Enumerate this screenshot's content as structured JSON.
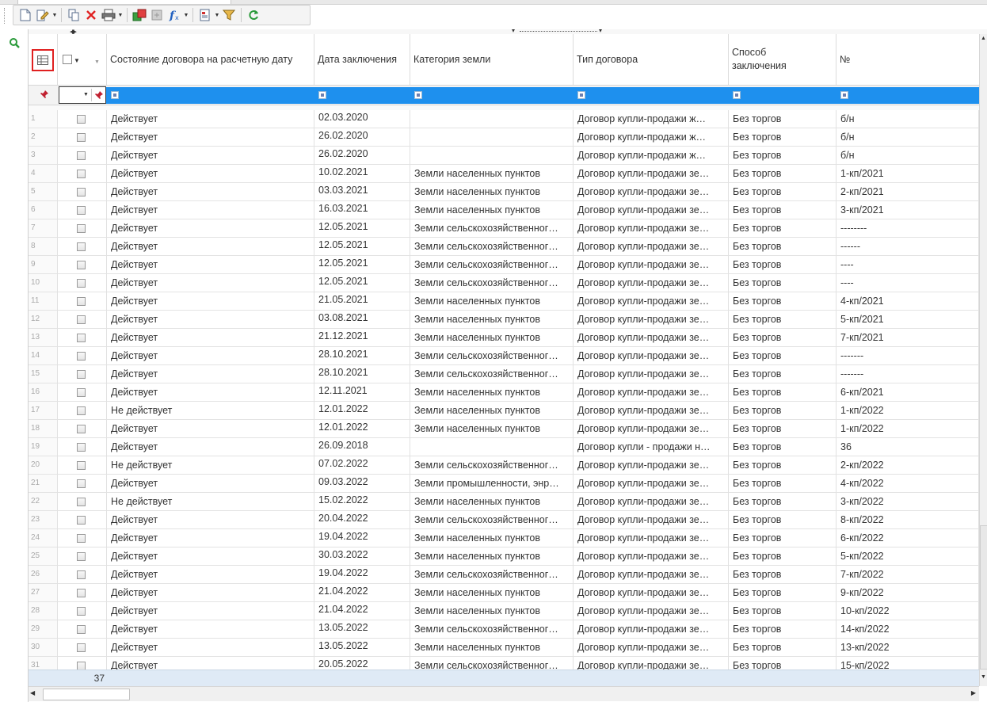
{
  "columns": {
    "state": "Состояние договора на расчетную дату",
    "date": "Дата заключения",
    "category": "Категория земли",
    "type": "Тип договора",
    "method": "Способ заключения",
    "number": "№"
  },
  "rows": [
    {
      "n": "1",
      "state": "Действует",
      "date": "02.03.2020",
      "category": "",
      "type": "Договор купли-продажи ж…",
      "method": "Без торгов",
      "number": "б/н"
    },
    {
      "n": "2",
      "state": "Действует",
      "date": "26.02.2020",
      "category": "",
      "type": "Договор купли-продажи ж…",
      "method": "Без торгов",
      "number": "  б/н"
    },
    {
      "n": "3",
      "state": "Действует",
      "date": "26.02.2020",
      "category": "",
      "type": "Договор купли-продажи ж…",
      "method": "Без торгов",
      "number": "   б/н"
    },
    {
      "n": "4",
      "state": "Действует",
      "date": "10.02.2021",
      "category": "Земли населенных пунктов",
      "type": "Договор купли-продажи зе…",
      "method": "Без торгов",
      "number": "1-кп/2021"
    },
    {
      "n": "5",
      "state": "Действует",
      "date": "03.03.2021",
      "category": "Земли населенных пунктов",
      "type": "Договор купли-продажи зе…",
      "method": "Без торгов",
      "number": "2-кп/2021"
    },
    {
      "n": "6",
      "state": "Действует",
      "date": "16.03.2021",
      "category": "Земли населенных пунктов",
      "type": "Договор купли-продажи зе…",
      "method": "Без торгов",
      "number": "3-кп/2021"
    },
    {
      "n": "7",
      "state": "Действует",
      "date": "12.05.2021",
      "category": "Земли сельскохозяйственног…",
      "type": "Договор купли-продажи зе…",
      "method": "Без торгов",
      "number": "--------"
    },
    {
      "n": "8",
      "state": "Действует",
      "date": "12.05.2021",
      "category": "Земли сельскохозяйственног…",
      "type": "Договор купли-продажи зе…",
      "method": "Без торгов",
      "number": "------"
    },
    {
      "n": "9",
      "state": "Действует",
      "date": "12.05.2021",
      "category": "Земли сельскохозяйственног…",
      "type": "Договор купли-продажи зе…",
      "method": "Без торгов",
      "number": "----"
    },
    {
      "n": "10",
      "state": "Действует",
      "date": "12.05.2021",
      "category": "Земли сельскохозяйственног…",
      "type": "Договор купли-продажи зе…",
      "method": "Без торгов",
      "number": "----"
    },
    {
      "n": "11",
      "state": "Действует",
      "date": "21.05.2021",
      "category": "Земли населенных пунктов",
      "type": "Договор купли-продажи зе…",
      "method": "Без торгов",
      "number": "4-кп/2021"
    },
    {
      "n": "12",
      "state": "Действует",
      "date": "03.08.2021",
      "category": "Земли населенных пунктов",
      "type": "Договор купли-продажи зе…",
      "method": "Без торгов",
      "number": "5-кп/2021"
    },
    {
      "n": "13",
      "state": "Действует",
      "date": "21.12.2021",
      "category": "Земли населенных пунктов",
      "type": "Договор купли-продажи зе…",
      "method": "Без торгов",
      "number": "7-кп/2021"
    },
    {
      "n": "14",
      "state": "Действует",
      "date": "28.10.2021",
      "category": "Земли сельскохозяйственног…",
      "type": "Договор купли-продажи зе…",
      "method": "Без торгов",
      "number": "-------"
    },
    {
      "n": "15",
      "state": "Действует",
      "date": "28.10.2021",
      "category": "Земли сельскохозяйственног…",
      "type": "Договор купли-продажи зе…",
      "method": "Без торгов",
      "number": "-------"
    },
    {
      "n": "16",
      "state": "Действует",
      "date": "12.11.2021",
      "category": "Земли населенных пунктов",
      "type": "Договор купли-продажи зе…",
      "method": "Без торгов",
      "number": "6-кп/2021"
    },
    {
      "n": "17",
      "state": "Не действует",
      "date": "12.01.2022",
      "category": "Земли населенных пунктов",
      "type": "Договор купли-продажи зе…",
      "method": "Без торгов",
      "number": "1-кп/2022"
    },
    {
      "n": "18",
      "state": "Действует",
      "date": "12.01.2022",
      "category": "Земли населенных пунктов",
      "type": "Договор купли-продажи зе…",
      "method": "Без торгов",
      "number": "1-кп/2022"
    },
    {
      "n": "19",
      "state": "Действует",
      "date": "26.09.2018",
      "category": "",
      "type": "Договор купли - продажи н…",
      "method": "Без торгов",
      "number": "36"
    },
    {
      "n": "20",
      "state": "Не действует",
      "date": "07.02.2022",
      "category": "Земли сельскохозяйственног…",
      "type": "Договор купли-продажи зе…",
      "method": "Без торгов",
      "number": "2-кп/2022"
    },
    {
      "n": "21",
      "state": "Действует",
      "date": "09.03.2022",
      "category": "Земли промышленности, энр…",
      "type": "Договор купли-продажи зе…",
      "method": "Без торгов",
      "number": "4-кп/2022"
    },
    {
      "n": "22",
      "state": "Не действует",
      "date": "15.02.2022",
      "category": "Земли населенных пунктов",
      "type": "Договор купли-продажи зе…",
      "method": "Без торгов",
      "number": "3-кп/2022"
    },
    {
      "n": "23",
      "state": "Действует",
      "date": "20.04.2022",
      "category": "Земли сельскохозяйственног…",
      "type": "Договор купли-продажи зе…",
      "method": "Без торгов",
      "number": "8-кп/2022"
    },
    {
      "n": "24",
      "state": "Действует",
      "date": "19.04.2022",
      "category": "Земли населенных пунктов",
      "type": "Договор купли-продажи зе…",
      "method": "Без торгов",
      "number": "6-кп/2022"
    },
    {
      "n": "25",
      "state": "Действует",
      "date": "30.03.2022",
      "category": "Земли населенных пунктов",
      "type": "Договор купли-продажи зе…",
      "method": "Без торгов",
      "number": "5-кп/2022"
    },
    {
      "n": "26",
      "state": "Действует",
      "date": "19.04.2022",
      "category": "Земли сельскохозяйственног…",
      "type": "Договор купли-продажи зе…",
      "method": "Без торгов",
      "number": "7-кп/2022"
    },
    {
      "n": "27",
      "state": "Действует",
      "date": "21.04.2022",
      "category": "Земли населенных пунктов",
      "type": "Договор купли-продажи зе…",
      "method": "Без торгов",
      "number": "9-кп/2022"
    },
    {
      "n": "28",
      "state": "Действует",
      "date": "21.04.2022",
      "category": "Земли населенных пунктов",
      "type": "Договор купли-продажи зе…",
      "method": "Без торгов",
      "number": "10-кп/2022"
    },
    {
      "n": "29",
      "state": "Действует",
      "date": "13.05.2022",
      "category": "Земли сельскохозяйственног…",
      "type": "Договор купли-продажи зе…",
      "method": "Без торгов",
      "number": "14-кп/2022"
    },
    {
      "n": "30",
      "state": "Действует",
      "date": "13.05.2022",
      "category": "Земли населенных пунктов",
      "type": "Договор купли-продажи зе…",
      "method": "Без торгов",
      "number": "13-кп/2022"
    },
    {
      "n": "31",
      "state": "Действует",
      "date": "20.05.2022",
      "category": "Земли сельскохозяйственног…",
      "type": "Договор купли-продажи зе…",
      "method": "Без торгов",
      "number": "15-кп/2022"
    }
  ],
  "footer": {
    "count": "37"
  },
  "icons": {
    "toolbar": [
      "new-document-icon",
      "edit-icon",
      "copy-icon",
      "delete-icon",
      "print-icon",
      "export-icon",
      "import-icon",
      "formula-icon",
      "report-icon",
      "filter-icon",
      "refresh-icon"
    ],
    "left": "search-icon"
  },
  "colors": {
    "filter_bar": "#1e90ee",
    "highlight": "#e02020",
    "footer": "#dfeaf6"
  }
}
